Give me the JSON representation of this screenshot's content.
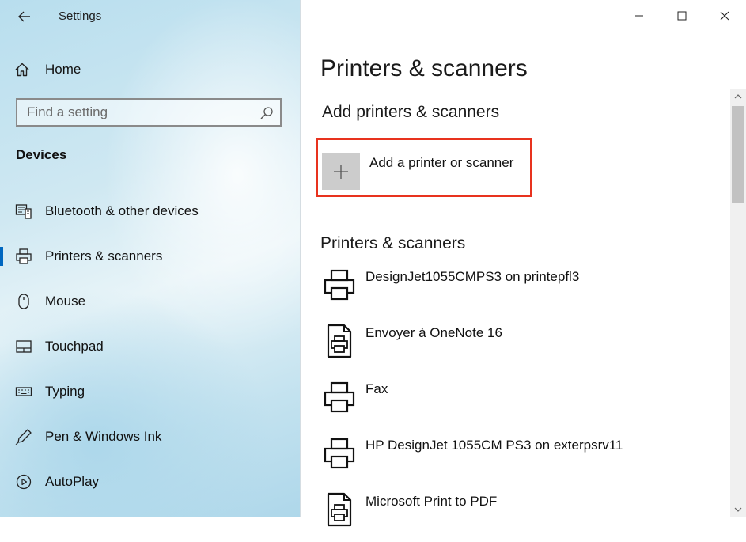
{
  "window": {
    "title": "Settings"
  },
  "sidebar": {
    "home_label": "Home",
    "search_placeholder": "Find a setting",
    "section_title": "Devices",
    "items": [
      {
        "label": "Bluetooth & other devices",
        "icon": "bluetooth-devices-icon",
        "selected": false
      },
      {
        "label": "Printers & scanners",
        "icon": "printer-icon",
        "selected": true
      },
      {
        "label": "Mouse",
        "icon": "mouse-icon",
        "selected": false
      },
      {
        "label": "Touchpad",
        "icon": "touchpad-icon",
        "selected": false
      },
      {
        "label": "Typing",
        "icon": "keyboard-icon",
        "selected": false
      },
      {
        "label": "Pen & Windows Ink",
        "icon": "pen-icon",
        "selected": false
      },
      {
        "label": "AutoPlay",
        "icon": "autoplay-icon",
        "selected": false
      }
    ]
  },
  "main": {
    "title": "Printers & scanners",
    "add_section_title": "Add printers & scanners",
    "add_button_label": "Add a printer or scanner",
    "list_section_title": "Printers & scanners",
    "printers": [
      {
        "name": "DesignJet1055CMPS3 on printepfl3",
        "icon": "printer-icon"
      },
      {
        "name": "Envoyer à OneNote 16",
        "icon": "document-printer-icon"
      },
      {
        "name": "Fax",
        "icon": "printer-icon"
      },
      {
        "name": "HP DesignJet 1055CM PS3 on exterpsrv11",
        "icon": "printer-icon"
      },
      {
        "name": "Microsoft Print to PDF",
        "icon": "document-printer-icon"
      }
    ]
  },
  "colors": {
    "highlight_border": "#e8321e",
    "selection_accent": "#0067c0",
    "add_tile_bg": "#cccccc"
  }
}
